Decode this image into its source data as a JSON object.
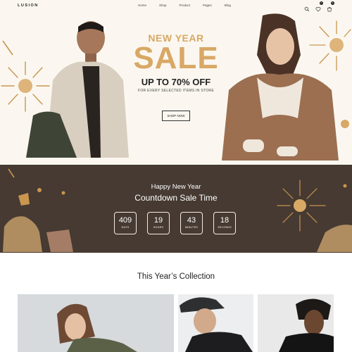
{
  "brand": {
    "logo": "LUSION"
  },
  "nav": {
    "items": [
      "Home",
      "Shop",
      "Product",
      "Pages",
      "Blog"
    ],
    "icons": [
      "search-icon",
      "heart-icon",
      "cart-icon"
    ],
    "wishlist_count": "0",
    "cart_count": "0"
  },
  "hero": {
    "subtitle": "NEW YEAR",
    "title": "SALE",
    "discount": "UP TO 70% OFF",
    "note": "FOR EVERY SELECTED ITEMS IN STORE",
    "button": "SHOP NOW"
  },
  "countdown": {
    "title": "Happy New Year",
    "subtitle": "Countdown Sale Time",
    "units": [
      {
        "value": "409",
        "label": "DAYS"
      },
      {
        "value": "19",
        "label": "HOURS"
      },
      {
        "value": "43",
        "label": "MINUTES"
      },
      {
        "value": "18",
        "label": "SECONDS"
      }
    ]
  },
  "collection": {
    "title": "This Year’s Collection"
  },
  "colors": {
    "accent_gold": "#d8a865",
    "hero_bg": "#fbf7f0",
    "countdown_bg": "#463a32"
  }
}
